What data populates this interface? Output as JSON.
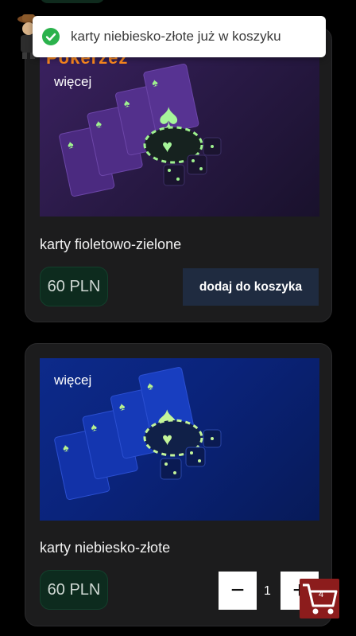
{
  "toast": {
    "message": "karty niebiesko-złote już w koszyku",
    "icon": "check-circle-icon",
    "color": "#2bb24c"
  },
  "header": {
    "partial_title": "Pokerzeź"
  },
  "products": [
    {
      "more_label": "więcej",
      "title": "karty fioletowo-zielone",
      "price": "60 PLN",
      "add_label": "dodaj do koszyka"
    },
    {
      "more_label": "więcej",
      "title": "karty niebiesko-złote",
      "price": "60 PLN",
      "quantity": "1",
      "minus_symbol": "−",
      "plus_symbol": "+"
    }
  ],
  "cart": {
    "count": "4",
    "icon": "cart-icon",
    "color": "#8c1c1c"
  }
}
